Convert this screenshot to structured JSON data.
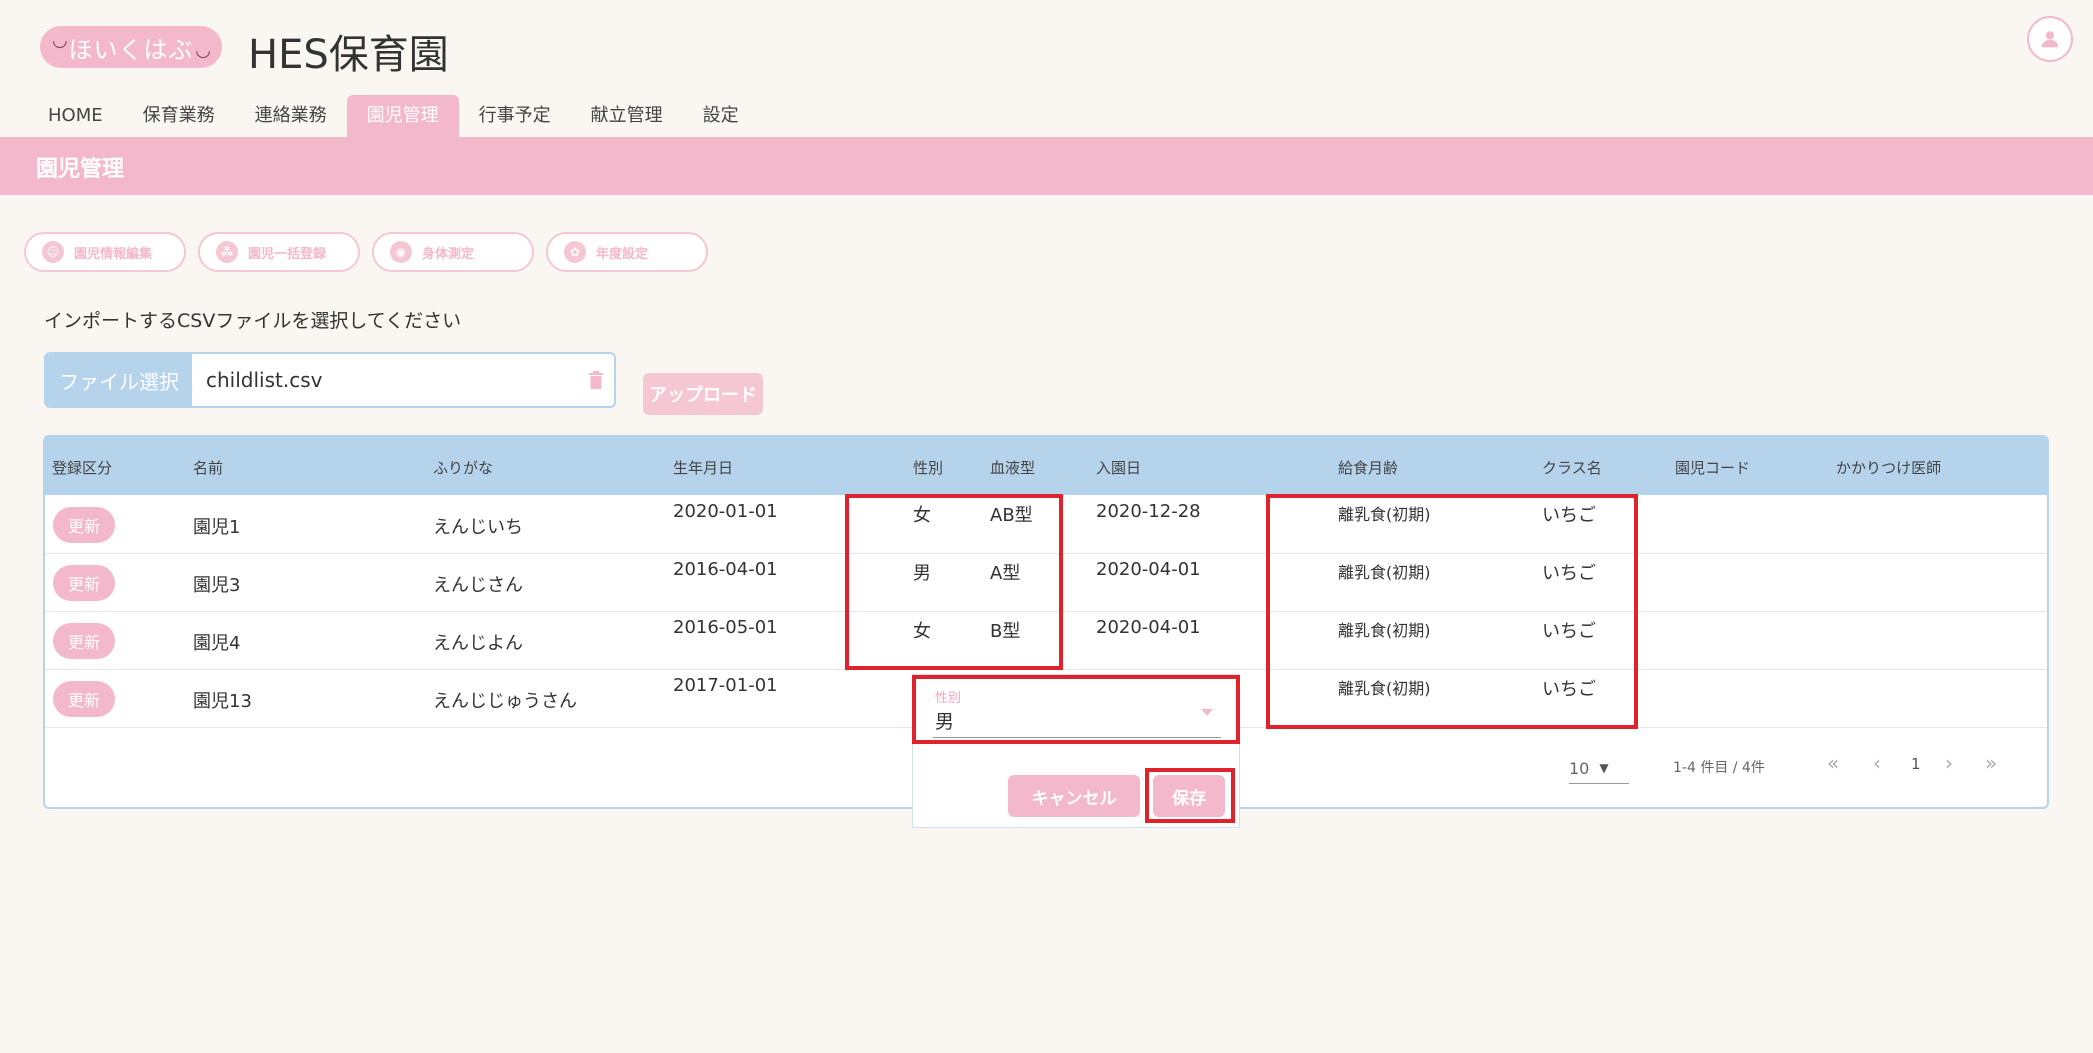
{
  "header": {
    "logo_text": "ほいくはぶ",
    "site_title": "HES保育園"
  },
  "nav": {
    "tabs": [
      {
        "label": "HOME"
      },
      {
        "label": "保育業務"
      },
      {
        "label": "連絡業務"
      },
      {
        "label": "園児管理"
      },
      {
        "label": "行事予定"
      },
      {
        "label": "献立管理"
      },
      {
        "label": "設定"
      }
    ],
    "active_index": 3
  },
  "banner": {
    "title": "園児管理"
  },
  "actions": [
    {
      "label": "園児情報編集",
      "icon": "child-edit-icon"
    },
    {
      "label": "園児一括登録",
      "icon": "group-register-icon"
    },
    {
      "label": "身体測定",
      "icon": "measure-icon"
    },
    {
      "label": "年度設定",
      "icon": "year-settings-icon"
    }
  ],
  "import": {
    "instruction": "インポートするCSVファイルを選択してください",
    "file_button_label": "ファイル選択",
    "file_name": "childlist.csv",
    "upload_label": "アップロード"
  },
  "table": {
    "headers": [
      "登録区分",
      "名前",
      "ふりがな",
      "生年月日",
      "性別",
      "血液型",
      "入園日",
      "給食月齢",
      "クラス名",
      "園児コード",
      "かかりつけ医師"
    ],
    "rows": [
      {
        "status": "更新",
        "name": "園児1",
        "kana": "えんじいち",
        "birth": "2020-01-01",
        "gender": "女",
        "blood": "AB型",
        "admission": "2020-12-28",
        "meal": "離乳食(初期)",
        "class": "いちご"
      },
      {
        "status": "更新",
        "name": "園児3",
        "kana": "えんじさん",
        "birth": "2016-04-01",
        "gender": "男",
        "blood": "A型",
        "admission": "2020-04-01",
        "meal": "離乳食(初期)",
        "class": "いちご"
      },
      {
        "status": "更新",
        "name": "園児4",
        "kana": "えんじよん",
        "birth": "2016-05-01",
        "gender": "女",
        "blood": "B型",
        "admission": "2020-04-01",
        "meal": "離乳食(初期)",
        "class": "いちご"
      },
      {
        "status": "更新",
        "name": "園児13",
        "kana": "えんじじゅうさん",
        "birth": "2017-01-01",
        "gender": "",
        "blood": "",
        "admission": "",
        "meal": "離乳食(初期)",
        "class": "いちご"
      }
    ]
  },
  "pagination": {
    "per_page": "10",
    "range_text": "1-4 件目 / 4件",
    "page": "1"
  },
  "edit_popup": {
    "field_label": "性別",
    "value": "男",
    "cancel_label": "キャンセル",
    "save_label": "保存"
  },
  "colors": {
    "accent": "#f4b8cc",
    "header_blue": "#b6d3ec",
    "highlight_red": "#e0222d",
    "background": "#faf7f3"
  }
}
